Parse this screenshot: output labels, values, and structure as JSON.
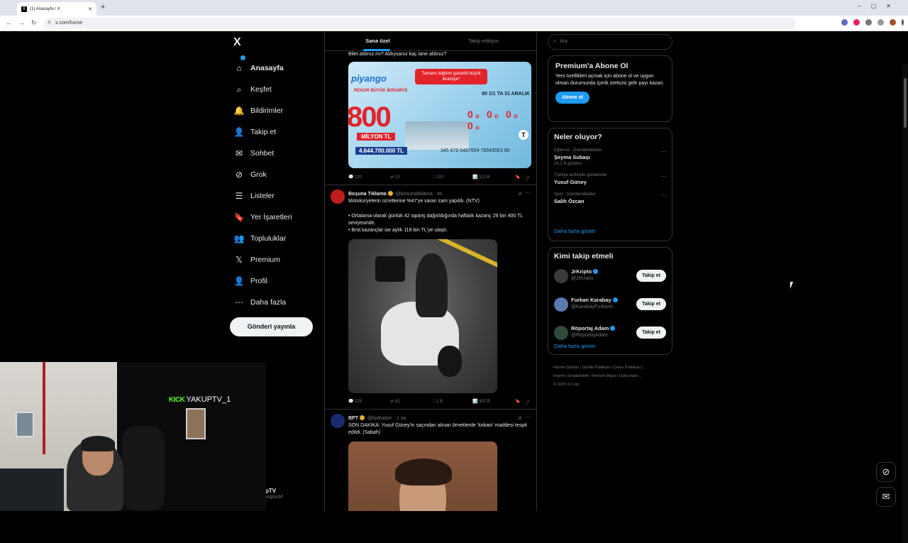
{
  "browser": {
    "tab_title": "(1) Anasayfa / X",
    "url": "x.com/home"
  },
  "sidebar": {
    "logo": "X",
    "items": [
      {
        "label": "Anasayfa",
        "icon": "home-icon",
        "glyph": "⌂"
      },
      {
        "label": "Keşfet",
        "icon": "search-icon",
        "glyph": "⌕"
      },
      {
        "label": "Bildirimler",
        "icon": "bell-icon",
        "glyph": "🔔"
      },
      {
        "label": "Takip et",
        "icon": "add-person-icon",
        "glyph": "👤"
      },
      {
        "label": "Sohbet",
        "icon": "mail-icon",
        "glyph": "✉"
      },
      {
        "label": "Grok",
        "icon": "grok-icon",
        "glyph": "⊘"
      },
      {
        "label": "Listeler",
        "icon": "list-icon",
        "glyph": "☰"
      },
      {
        "label": "Yer İşaretleri",
        "icon": "bookmark-icon",
        "glyph": "🔖"
      },
      {
        "label": "Topluluklar",
        "icon": "people-icon",
        "glyph": "👥"
      },
      {
        "label": "Premium",
        "icon": "x-icon",
        "glyph": "𝕏"
      },
      {
        "label": "Profil",
        "icon": "person-icon",
        "glyph": "👤"
      },
      {
        "label": "Daha fazla",
        "icon": "more-circle-icon",
        "glyph": "⋯"
      }
    ],
    "post_button": "Gönderi yayınla",
    "account": {
      "name": "pTV",
      "handle": "xuptv34"
    }
  },
  "feed": {
    "tabs": [
      "Sana özel",
      "Takip ediliyor"
    ],
    "tweets": [
      {
        "text": "Bilet aldınız mı? Aldıysanız kaç tane aldınız?",
        "image": {
          "brand": "piyango",
          "banner": "Tamamı dağıtım garantili büyük ikramiye*",
          "rekor": "REKOR BÜYÜK İKRAMİYE",
          "big": "800",
          "million": "MİLYON TL",
          "amount": "4.644.700.000 TL",
          "date": "80 1/1 TA 31 ARALIK",
          "numbers": "345 679 5487654 76543563 98",
          "zeros": "0₀ 0₀ 0₀ 0₀",
          "logo": "T"
        },
        "stats": {
          "replies": "120",
          "reposts": "13",
          "likes": "210",
          "views": "112 B"
        }
      },
      {
        "author": "Boşuna Tıklama",
        "handle": "@bosunatiklama",
        "time": "4s",
        "text": "Motokuryelerin ücretlerine %47'ye varan zam yapıldı. (NTV)",
        "bullets": [
          "• Ortalama olarak günlük 42 sipariş dağıtıldığında haftalık kazanç 29 bin 400 TL seviyesinde.",
          "• Brüt kazançlar ise aylık 118 bin TL'ye ulaştı."
        ],
        "stats": {
          "replies": "225",
          "reposts": "83",
          "likes": "1 B",
          "views": "497 B"
        }
      },
      {
        "author": "BPT",
        "handle": "@bpthaber",
        "time": "1 sa",
        "text": "SON DAKİKA: Yusuf Güney'in saçından alınan örneklerde 'kokain' maddesi tespit edildi. (Sabah)"
      }
    ]
  },
  "right": {
    "search_placeholder": "Ara",
    "premium": {
      "title": "Premium'a Abone Ol",
      "desc": "Yeni özellikleri açmak için abone ol ve uygun olman durumunda içerik üreticisi gelir payı kazan.",
      "button": "Abone ol"
    },
    "trends": {
      "title": "Neler oluyor?",
      "items": [
        {
          "category": "Eğlence · Gündemdekiler",
          "topic": "Şeyma Subaşı",
          "count": "14,2 B gönderi"
        },
        {
          "category": "Türkiye tarihinde gündemde",
          "topic": "Yusuf Güney",
          "count": ""
        },
        {
          "category": "Spor · Gündemdekiler",
          "topic": "Salih Özcan",
          "count": ""
        }
      ],
      "more": "Daha fazla göster"
    },
    "who": {
      "title": "Kimi takip etmeli",
      "items": [
        {
          "name": "JrKripto",
          "handle": "@JrKripto",
          "button": "Takip et"
        },
        {
          "name": "Furkan Karabay",
          "handle": "@KarabayFurkann",
          "button": "Takip et"
        },
        {
          "name": "Röportaj Adam",
          "handle": "@RoportajAdam",
          "button": "Takip et"
        }
      ],
      "more": "Daha fazla göster"
    },
    "footer": {
      "line1": "Hizmet Şartları  |  Gizlilik Politikası  |  Çerez Politikası  |",
      "line2": "Imprint  |  Erişilebilirlik  |  Reklam bilgisi  |  Daha fazla ...",
      "line3": "© 2025 X Corp."
    }
  },
  "webcam": {
    "kick_logo": "KICK",
    "channel": "YAKUPTV_1"
  },
  "colors": {
    "accent": "#1d9bf0",
    "background": "#000000",
    "kick": "#53fc18"
  }
}
